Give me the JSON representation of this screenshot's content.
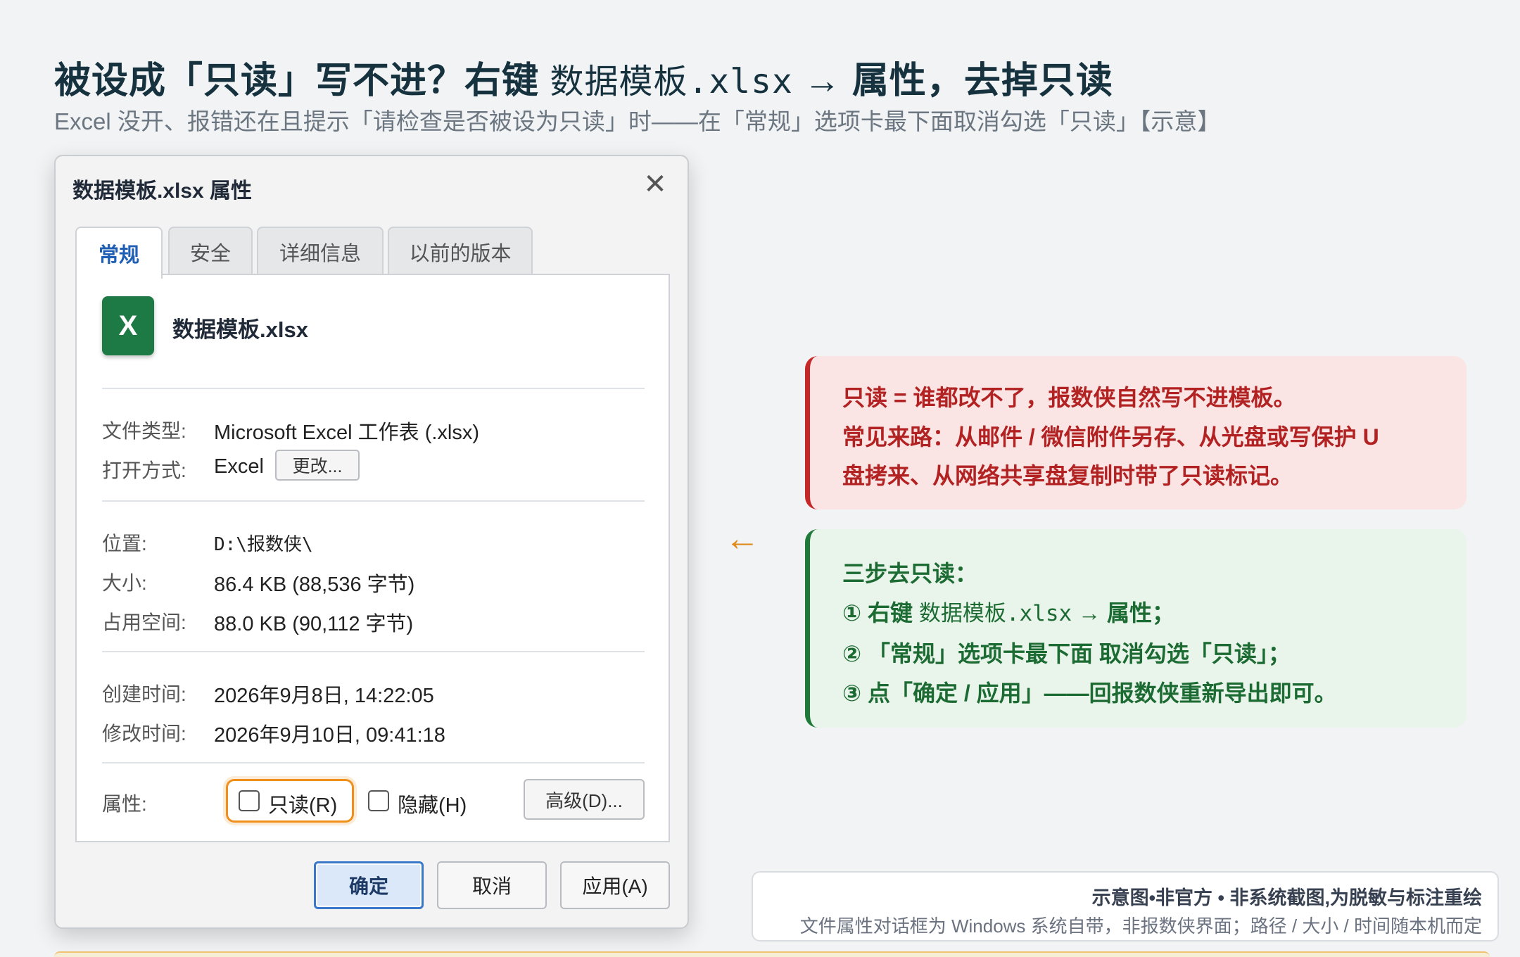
{
  "header": {
    "title_pre": "被设成「只读」写不进？右键 ",
    "title_file": "数据模板.xlsx",
    "title_post": " → 属性，去掉只读",
    "subtitle": "Excel 没开、报错还在且提示「请检查是否被设为只读」时——在「常规」选项卡最下面取消勾选「只读」【示意】"
  },
  "dialog": {
    "title": "数据模板.xlsx 属性",
    "close_glyph": "✕",
    "tabs": [
      {
        "label": "常规",
        "active": true
      },
      {
        "label": "安全",
        "active": false
      },
      {
        "label": "详细信息",
        "active": false
      },
      {
        "label": "以前的版本",
        "active": false
      }
    ],
    "file_icon_letter": "X",
    "file_name": "数据模板.xlsx",
    "file_type_label": "文件类型:",
    "file_type_value": "Microsoft Excel 工作表 (.xlsx)",
    "open_with_label": "打开方式:",
    "open_with_value": "Excel",
    "change_button": "更改...",
    "location_label": "位置:",
    "location_value": "D:\\报数侠\\",
    "size_label": "大小:",
    "size_value": "86.4 KB (88,536 字节)",
    "size_on_disk_label": "占用空间:",
    "size_on_disk_value": "88.0 KB (90,112 字节)",
    "created_label": "创建时间:",
    "created_value": "2026年9月8日, 14:22:05",
    "modified_label": "修改时间:",
    "modified_value": "2026年9月10日, 09:41:18",
    "attributes_label": "属性:",
    "readonly_label": "只读(R)",
    "readonly_checked": false,
    "hidden_label": "隐藏(H)",
    "hidden_checked": false,
    "advanced_button": "高级(D)...",
    "ok_button": "确定",
    "cancel_button": "取消",
    "apply_button": "应用(A)"
  },
  "arrow_glyph": "←",
  "callout_red": {
    "line1": "只读 = 谁都改不了，报数侠自然写不进模板。",
    "line2": "常见来路：从邮件 / 微信附件另存、从光盘或写保护 U",
    "line3": "盘拷来、从网络共享盘复制时带了只读标记。",
    "color": "#c62828"
  },
  "callout_green": {
    "heading": "三步去只读：",
    "step1_pre": "① 右键 ",
    "step1_file": "数据模板.xlsx",
    "step1_post": " → 属性；",
    "step2": "② 「常规」选项卡最下面 取消勾选「只读」；",
    "step3": "③ 点「确定 / 应用」——回报数侠重新导出即可。",
    "color": "#1f7a3a"
  },
  "disclaimer": {
    "line1": "示意图•非官方 • 非系统截图,为脱敏与标注重绘",
    "line2": "文件属性对话框为 Windows 系统自带，非报数侠界面；路径 / 大小 / 时间随本机而定"
  },
  "colors": {
    "highlight_orange": "#ef8f1c",
    "excel_green": "#1d7a45",
    "primary_blue": "#3a78c9"
  }
}
